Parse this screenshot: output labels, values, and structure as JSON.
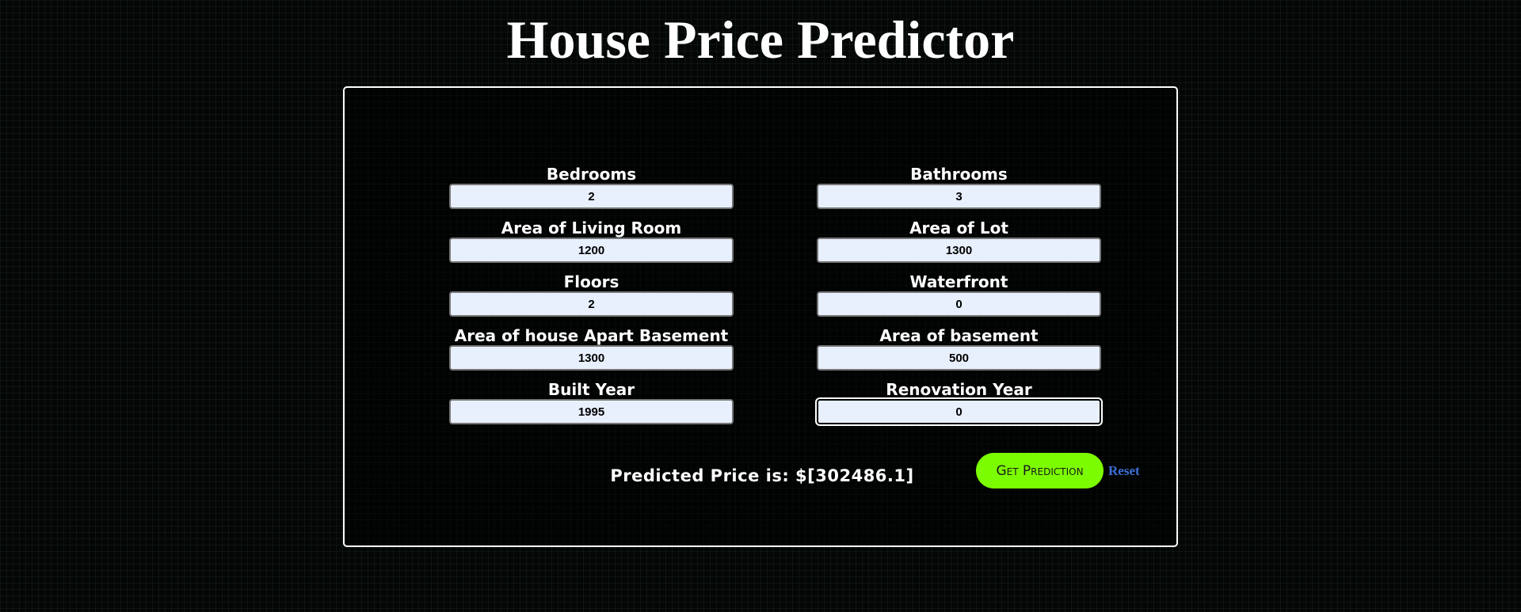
{
  "page": {
    "title": "House Price Predictor"
  },
  "form": {
    "fields": [
      {
        "label": "Bedrooms",
        "value": "2"
      },
      {
        "label": "Bathrooms",
        "value": "3"
      },
      {
        "label": "Area of Living Room",
        "value": "1200"
      },
      {
        "label": "Area of Lot",
        "value": "1300"
      },
      {
        "label": "Floors",
        "value": "2"
      },
      {
        "label": "Waterfront",
        "value": "0"
      },
      {
        "label": "Area of house Apart Basement",
        "value": "1300"
      },
      {
        "label": "Area of basement",
        "value": "500"
      },
      {
        "label": "Built Year",
        "value": "1995"
      },
      {
        "label": "Renovation Year",
        "value": "0"
      }
    ],
    "result_text": "Predicted Price is: $[302486.1]",
    "predict_label": "Get Prediction",
    "reset_label": "Reset"
  },
  "colors": {
    "background": "#040605",
    "accent": "#7cfc00",
    "link": "#3d6fd8",
    "input_bg": "#e8f0fe"
  }
}
